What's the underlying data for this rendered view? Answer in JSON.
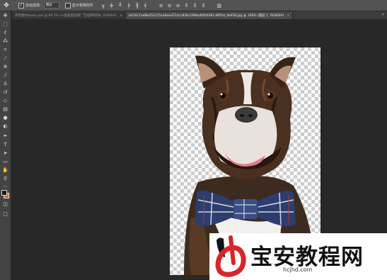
{
  "options_bar": {
    "tool_icon": "move-tool-icon",
    "auto_select_label": "自动选择:",
    "auto_select_value": "图层",
    "show_transform_label": "显示变换控件"
  },
  "tabs": [
    {
      "label": "开完素材anner.psd @ 66.7% (十倍速度标牌广告招牌制作8, RGB/8#)",
      "active": false
    },
    {
      "label": "b016c7ad8b452c55ea8eed72dcc838c199ba8f4fd481-WPOd_fw658.jpg @ 100% (图层 1, RGB/8#)",
      "active": true
    }
  ],
  "toolbar": {
    "tools": [
      "move-tool-icon",
      "marquee-tool-icon",
      "lasso-tool-icon",
      "magic-wand-icon",
      "crop-tool-icon",
      "eyedropper-icon",
      "healing-brush-icon",
      "brush-tool-icon",
      "clone-stamp-icon",
      "history-brush-icon",
      "eraser-icon",
      "gradient-tool-icon",
      "blur-tool-icon",
      "dodge-tool-icon",
      "pen-tool-icon",
      "type-tool-icon",
      "path-selection-icon",
      "shape-tool-icon",
      "hand-tool-icon",
      "zoom-tool-icon"
    ],
    "foreground_color": "#1a1a1a",
    "background_color": "#e85e1a"
  },
  "canvas": {
    "image_subject": "French bulldog with plaid bow tie on transparent background"
  },
  "watermark": {
    "title": "宝安教程网",
    "url": "hcjhd.com"
  }
}
